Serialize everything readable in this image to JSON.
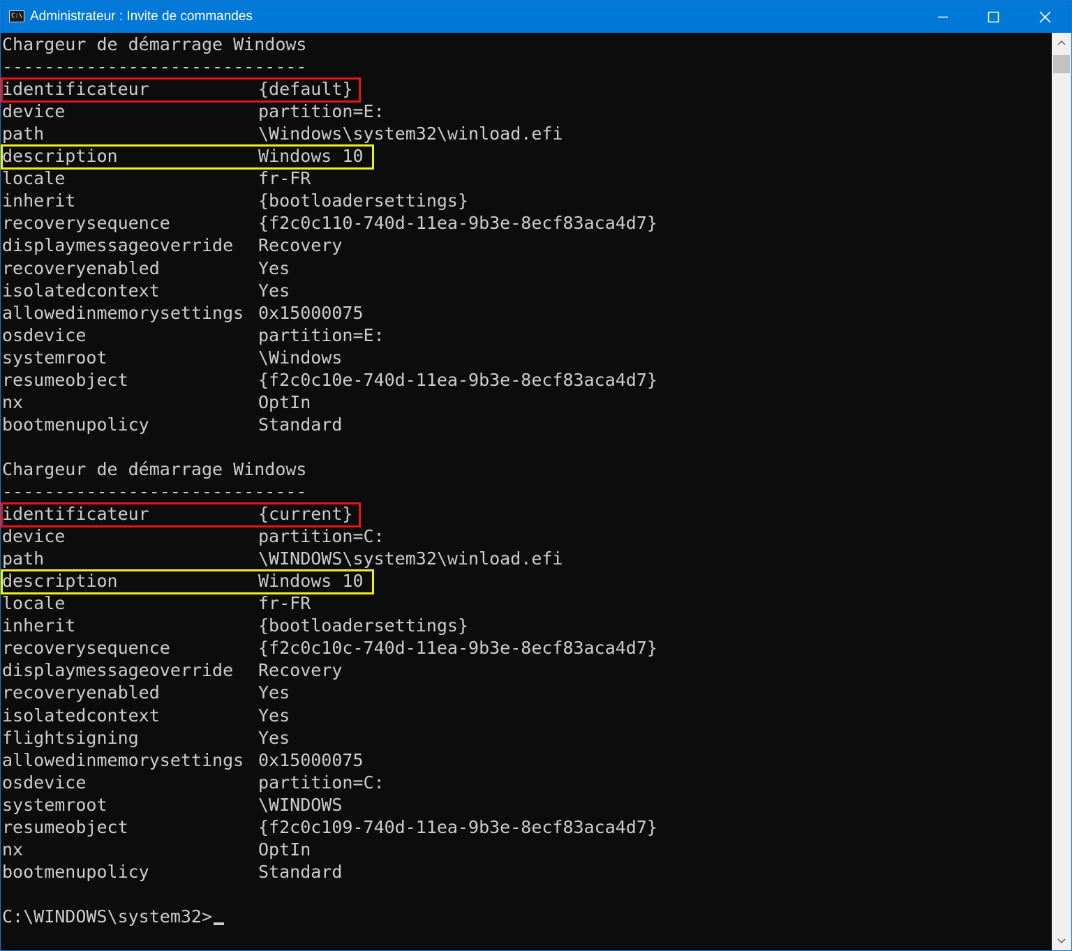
{
  "window": {
    "title": "Administrateur : Invite de commandes",
    "icon_text": "C:\\",
    "accent_color": "#0078d7"
  },
  "highlight_colors": {
    "identifier": "#e8141a",
    "description": "#f1f01a"
  },
  "console": {
    "sections": [
      {
        "header": "Chargeur de démarrage Windows",
        "separator": "-----------------------------",
        "rows": [
          {
            "key": "identificateur",
            "value": "{default}"
          },
          {
            "key": "device",
            "value": "partition=E:"
          },
          {
            "key": "path",
            "value": "\\Windows\\system32\\winload.efi"
          },
          {
            "key": "description",
            "value": "Windows 10"
          },
          {
            "key": "locale",
            "value": "fr-FR"
          },
          {
            "key": "inherit",
            "value": "{bootloadersettings}"
          },
          {
            "key": "recoverysequence",
            "value": "{f2c0c110-740d-11ea-9b3e-8ecf83aca4d7}"
          },
          {
            "key": "displaymessageoverride",
            "value": "Recovery"
          },
          {
            "key": "recoveryenabled",
            "value": "Yes"
          },
          {
            "key": "isolatedcontext",
            "value": "Yes"
          },
          {
            "key": "allowedinmemorysettings",
            "value": "0x15000075"
          },
          {
            "key": "osdevice",
            "value": "partition=E:"
          },
          {
            "key": "systemroot",
            "value": "\\Windows"
          },
          {
            "key": "resumeobject",
            "value": "{f2c0c10e-740d-11ea-9b3e-8ecf83aca4d7}"
          },
          {
            "key": "nx",
            "value": "OptIn"
          },
          {
            "key": "bootmenupolicy",
            "value": "Standard"
          }
        ]
      },
      {
        "header": "Chargeur de démarrage Windows",
        "separator": "-----------------------------",
        "rows": [
          {
            "key": "identificateur",
            "value": "{current}"
          },
          {
            "key": "device",
            "value": "partition=C:"
          },
          {
            "key": "path",
            "value": "\\WINDOWS\\system32\\winload.efi"
          },
          {
            "key": "description",
            "value": "Windows 10"
          },
          {
            "key": "locale",
            "value": "fr-FR"
          },
          {
            "key": "inherit",
            "value": "{bootloadersettings}"
          },
          {
            "key": "recoverysequence",
            "value": "{f2c0c10c-740d-11ea-9b3e-8ecf83aca4d7}"
          },
          {
            "key": "displaymessageoverride",
            "value": "Recovery"
          },
          {
            "key": "recoveryenabled",
            "value": "Yes"
          },
          {
            "key": "isolatedcontext",
            "value": "Yes"
          },
          {
            "key": "flightsigning",
            "value": "Yes"
          },
          {
            "key": "allowedinmemorysettings",
            "value": "0x15000075"
          },
          {
            "key": "osdevice",
            "value": "partition=C:"
          },
          {
            "key": "systemroot",
            "value": "\\WINDOWS"
          },
          {
            "key": "resumeobject",
            "value": "{f2c0c109-740d-11ea-9b3e-8ecf83aca4d7}"
          },
          {
            "key": "nx",
            "value": "OptIn"
          },
          {
            "key": "bootmenupolicy",
            "value": "Standard"
          }
        ]
      }
    ],
    "prompt": "C:\\WINDOWS\\system32>"
  }
}
